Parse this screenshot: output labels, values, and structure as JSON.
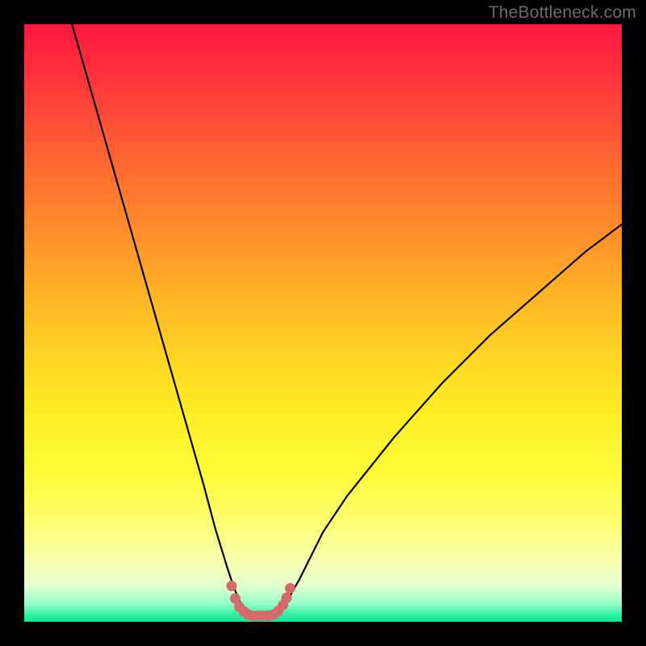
{
  "watermark": {
    "text": "TheBottleneck.com"
  },
  "chart_data": {
    "type": "line",
    "title": "",
    "xlabel": "",
    "ylabel": "",
    "xlim": [
      0,
      100
    ],
    "ylim": [
      0,
      100
    ],
    "grid": false,
    "legend": false,
    "background": "rainbow-gradient-vertical",
    "series": [
      {
        "name": "bottleneck-curve",
        "color": "#000000",
        "x": [
          8,
          10,
          12,
          14,
          16,
          18,
          20,
          22,
          24,
          26,
          28,
          30,
          32,
          34,
          35,
          36,
          37,
          38,
          39,
          40,
          41,
          42,
          43,
          44,
          46,
          48,
          50,
          54,
          58,
          62,
          66,
          70,
          74,
          78,
          82,
          86,
          90,
          94,
          98,
          100
        ],
        "y": [
          100,
          93,
          86,
          79,
          72,
          65,
          58,
          51,
          44,
          37,
          30,
          23,
          15.5,
          9,
          6,
          3.5,
          2,
          1.3,
          1,
          1,
          1,
          1.3,
          2,
          3.5,
          7,
          11,
          15,
          21,
          26,
          31,
          35.5,
          40,
          44,
          48,
          51.5,
          55,
          58.5,
          62,
          65,
          66.5
        ]
      },
      {
        "name": "sweet-spot-marker",
        "color": "#d56a6a",
        "style": "thick-dotted",
        "x": [
          34.7,
          35.3,
          36.0,
          36.8,
          37.5,
          38.3,
          39.2,
          40.0,
          40.8,
          41.7,
          42.5,
          43.3,
          43.9,
          44.5
        ],
        "y": [
          6.0,
          3.9,
          2.5,
          1.7,
          1.2,
          1.0,
          1.0,
          1.0,
          1.0,
          1.2,
          1.8,
          2.8,
          4.0,
          5.6
        ]
      }
    ]
  }
}
